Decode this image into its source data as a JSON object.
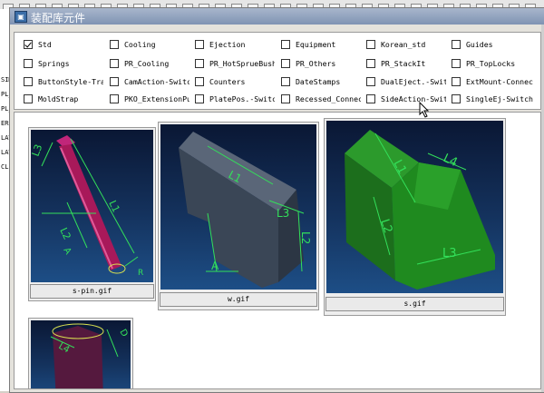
{
  "window": {
    "title": "装配库元件"
  },
  "background": {
    "side_labels": [
      "SIM",
      "PL_",
      "PL_",
      "ERS",
      "LAT",
      "LAT",
      "CLP"
    ]
  },
  "checkboxes": [
    {
      "label": "Std",
      "checked": true
    },
    {
      "label": "Cooling",
      "checked": false
    },
    {
      "label": "Ejection",
      "checked": false
    },
    {
      "label": "Equipment",
      "checked": false
    },
    {
      "label": "Korean_std",
      "checked": false
    },
    {
      "label": "Guides",
      "checked": false
    },
    {
      "label": "Springs",
      "checked": false
    },
    {
      "label": "PR_Cooling",
      "checked": false
    },
    {
      "label": "PR_HotSprueBush",
      "checked": false
    },
    {
      "label": "PR_Others",
      "checked": false
    },
    {
      "label": "PR_StackIt",
      "checked": false
    },
    {
      "label": "PR_TopLocks",
      "checked": false
    },
    {
      "label": "ButtonStyle-Tra",
      "checked": false
    },
    {
      "label": "CamAction-Switc",
      "checked": false
    },
    {
      "label": "Counters",
      "checked": false
    },
    {
      "label": "DateStamps",
      "checked": false
    },
    {
      "label": "DualEject.-Swit",
      "checked": false
    },
    {
      "label": "ExtMount-Connec",
      "checked": false
    },
    {
      "label": "MoldStrap",
      "checked": false
    },
    {
      "label": "PKO_ExtensionPu",
      "checked": false
    },
    {
      "label": "PlatePos.-Switc",
      "checked": false
    },
    {
      "label": "Recessed_Connec",
      "checked": false
    },
    {
      "label": "SideAction-Swit",
      "checked": false
    },
    {
      "label": "SingleEj-Switch",
      "checked": false
    }
  ],
  "thumbnails": [
    {
      "caption": "s-pin.gif",
      "dims": [
        "L3",
        "L2",
        "L1",
        "A",
        "R"
      ]
    },
    {
      "caption": "w.gif",
      "dims": [
        "L1",
        "L3",
        "L2",
        "A"
      ]
    },
    {
      "caption": "s.gif",
      "dims": [
        "L1",
        "L4",
        "L2",
        "L3"
      ]
    },
    {
      "caption": "",
      "dims": [
        "L4",
        "D"
      ]
    }
  ],
  "colors": {
    "thumb_bg": "#14325d",
    "dimension_lines": "#33e05a",
    "pin_color": "#a8195a",
    "wedge_color": "#3a4656",
    "slide_color": "#1f8a1f",
    "partial_color": "#55193e"
  }
}
